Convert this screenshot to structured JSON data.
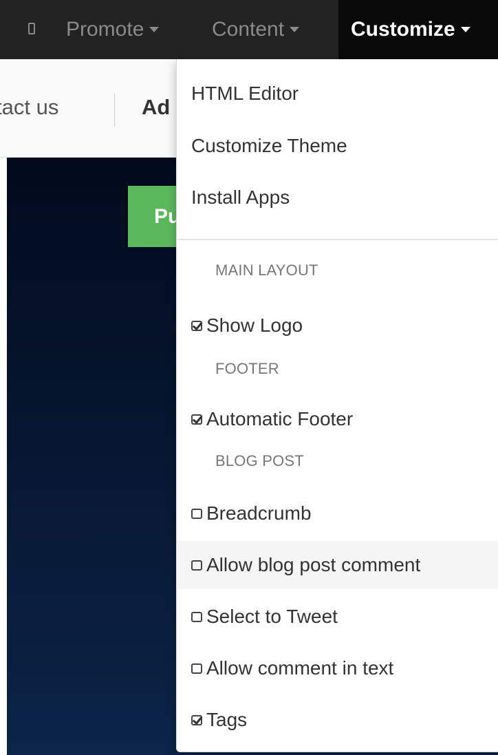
{
  "navbar": {
    "mobile_icon": "mobile-phone-icon",
    "items": [
      {
        "label": "Promote"
      },
      {
        "label": "Content"
      },
      {
        "label": "Customize"
      }
    ]
  },
  "subbar": {
    "contact_label": "tact us",
    "add_label": "Ad"
  },
  "hero": {
    "publish_label": "Pu"
  },
  "dropdown": {
    "links": [
      {
        "label": "HTML Editor"
      },
      {
        "label": "Customize Theme"
      },
      {
        "label": "Install Apps"
      }
    ],
    "sections": {
      "main_layout": "MAIN LAYOUT",
      "footer": "FOOTER",
      "blog_post": "BLOG POST"
    },
    "options": {
      "show_logo": {
        "label": "Show Logo",
        "checked": true
      },
      "automatic_footer": {
        "label": "Automatic Footer",
        "checked": true
      },
      "breadcrumb": {
        "label": "Breadcrumb",
        "checked": false
      },
      "allow_blog_post_comment": {
        "label": "Allow blog post comment",
        "checked": false
      },
      "select_to_tweet": {
        "label": "Select to Tweet",
        "checked": false
      },
      "allow_comment_in_text": {
        "label": "Allow comment in text",
        "checked": false
      },
      "tags": {
        "label": "Tags",
        "checked": true
      }
    }
  },
  "colors": {
    "navbar_bg": "#222222",
    "nav_active_bg": "#0a0a0a",
    "publish_green": "#5cb85c",
    "hero_dark": "#061630"
  }
}
